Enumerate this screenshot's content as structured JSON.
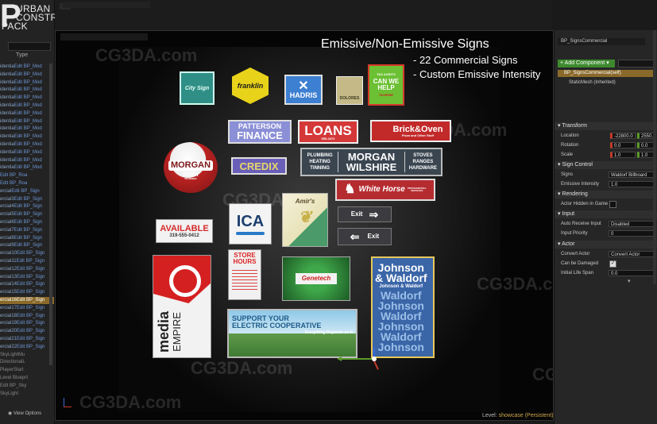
{
  "logo": {
    "letter": "P",
    "line1": "URBAN",
    "line2": "CONSTRUCTION",
    "line3": "PACK"
  },
  "outliner": {
    "col_header": "Type",
    "rows": [
      {
        "a": "identia",
        "b": "Edit BP_Mod"
      },
      {
        "a": "identia",
        "b": "Edit BP_Mod"
      },
      {
        "a": "identia",
        "b": "Edit BP_Mod"
      },
      {
        "a": "identia",
        "b": "Edit BP_Mod"
      },
      {
        "a": "identia",
        "b": "Edit BP_Mod"
      },
      {
        "a": "identia",
        "b": "Edit BP_Mod"
      },
      {
        "a": "identia",
        "b": "Edit BP_Mod"
      },
      {
        "a": "identia",
        "b": "Edit BP_Mod"
      },
      {
        "a": "identia",
        "b": "Edit BP_Mod"
      },
      {
        "a": "identia",
        "b": "Edit BP_Mod"
      },
      {
        "a": "identia",
        "b": "Edit BP_Mod"
      },
      {
        "a": "identia",
        "b": "Edit BP_Mod"
      },
      {
        "a": "identia",
        "b": "Edit BP_Mod"
      },
      {
        "a": "identia",
        "b": "Edit BP_Mod"
      },
      {
        "a": "",
        "b": "Edit BP_Roa"
      },
      {
        "a": "",
        "b": "Edit BP_Roa"
      },
      {
        "a": "ercial",
        "b": "Edit BP_Sign"
      },
      {
        "a": "ercial3",
        "b": "Edit BP_Sign"
      },
      {
        "a": "ercial4",
        "b": "Edit BP_Sign"
      },
      {
        "a": "ercial5",
        "b": "Edit BP_Sign"
      },
      {
        "a": "ercial6",
        "b": "Edit BP_Sign"
      },
      {
        "a": "ercial7",
        "b": "Edit BP_Sign"
      },
      {
        "a": "ercial8",
        "b": "Edit BP_Sign"
      },
      {
        "a": "ercial9",
        "b": "Edit BP_Sign"
      },
      {
        "a": "ercial10",
        "b": "Edit BP_Sign"
      },
      {
        "a": "ercial11",
        "b": "Edit BP_Sign"
      },
      {
        "a": "ercial12",
        "b": "Edit BP_Sign"
      },
      {
        "a": "ercial13",
        "b": "Edit BP_Sign"
      },
      {
        "a": "ercial14",
        "b": "Edit BP_Sign"
      },
      {
        "a": "ercial15",
        "b": "Edit BP_Sign"
      },
      {
        "a": "ercial16",
        "b": "Edit BP_Sign"
      },
      {
        "a": "ercial17",
        "b": "Edit BP_Sign"
      },
      {
        "a": "ercial18",
        "b": "Edit BP_Sign"
      },
      {
        "a": "ercial19",
        "b": "Edit BP_Sign"
      },
      {
        "a": "ercial20",
        "b": "Edit BP_Sign"
      },
      {
        "a": "ercial21",
        "b": "Edit BP_Sign"
      },
      {
        "a": "ercial22",
        "b": "Edit BP_Sign"
      },
      {
        "a": "",
        "b": "SkyLightMu"
      },
      {
        "a": "",
        "b": "DirectionalL"
      },
      {
        "a": "",
        "b": "PlayerStart"
      },
      {
        "a": "",
        "b": "Level Blueprt"
      },
      {
        "a": "",
        "b": "Edit BP_Sky"
      },
      {
        "a": "",
        "b": "SkyLight"
      }
    ],
    "selected_index": 30,
    "view_options": "View Options"
  },
  "viewport": {
    "watermark": "CG3DA.com",
    "caption_title": "Emissive/Non-Emissive Signs",
    "caption_line1": "- 22 Commercial Signs",
    "caption_line2": "- Custom Emissive Intensity",
    "level_label": "Level:",
    "level_name": "showcase (Persistent)",
    "signs": {
      "city": "City Sign",
      "franklin": "franklin",
      "hadris": "HADRIS",
      "dolores": "DOLORES",
      "taxhelp_top": "TAX AUDITS",
      "taxhelp": "CAN WE HELP",
      "taxhelp_bot": "TAXIFINE",
      "patterson1": "PATTERSON",
      "patterson2": "FINANCE",
      "loans": "LOANS",
      "loans_phone": "555-4472",
      "brick": "Brick&Oven",
      "brick_sub": "Pizza and Other Stuff",
      "morgan_beer1": "MORGAN",
      "morgan_beer2": "BEER",
      "morgan_beer3": "PILSENER",
      "credix": "CREDIX",
      "plumbing1": "PLUMBING",
      "plumbing2": "HEATING",
      "plumbing3": "TINNING",
      "morgan1": "MORGAN",
      "morgan2": "WILSHIRE",
      "stoves1": "STOVES",
      "stoves2": "RANGES",
      "stoves3": "HARDWARE",
      "whitehorse": "White Horse",
      "whitehorse_sub": "PROFESSIONAL SERVICES",
      "available": "AVAILABLE",
      "available_phone": "319-555-0412",
      "ica": "ICA",
      "amirs": "Amir's",
      "exit1": "Exit",
      "exit2": "Exit",
      "store1": "STORE",
      "store2": "HOURS",
      "genetech": "Genetech",
      "johnson_words": [
        "Johnson",
        "& Waldorf",
        "Johnson & Waldorf",
        "Waldorf",
        "Johnson",
        "Waldorf",
        "Johnson",
        "Waldorf",
        "Johnson"
      ],
      "media1": "media",
      "media2": "EMPIRE",
      "support1": "SUPPORT YOUR",
      "support2": "ELECTRIC COOPERATIVE",
      "support3": "Everything Depends on It"
    }
  },
  "details": {
    "tab": "BP_SignsCommercial",
    "add_component": "+ Add Component",
    "self_item": "BP_SignsCommercial(self)",
    "static_mesh": "StaticMesh (Inherited)",
    "transform": "Transform",
    "location_label": "Location",
    "location_x": "-22800.0",
    "location_y": "2550.0",
    "rotation_label": "Rotation",
    "rotation_x": "0.0",
    "rotation_y": "0.0",
    "scale_label": "Scale",
    "scale_x": "1.0",
    "scale_y": "1.0",
    "sign_control": "Sign Control",
    "signs_label": "Signs",
    "signs_value": "Waldorf Billboard",
    "emissive_label": "Emissive Intensity",
    "emissive_value": "1.0",
    "rendering": "Rendering",
    "hidden_label": "Actor Hidden in Game",
    "input": "Input",
    "auto_receive_label": "Auto Receive Input",
    "auto_receive_value": "Disabled",
    "input_priority_label": "Input Priority",
    "input_priority_value": "0",
    "actor": "Actor",
    "convert_label": "Convert Actor",
    "convert_value": "Convert Actor",
    "damaged_label": "Can be Damaged",
    "lifespan_label": "Initial Life Span",
    "lifespan_value": "0.0"
  },
  "colors": {
    "selection": "#8a6a2a",
    "add_button": "#3d8a2e",
    "x_axis": "#c43a2a",
    "y_axis": "#5a9a2a"
  }
}
